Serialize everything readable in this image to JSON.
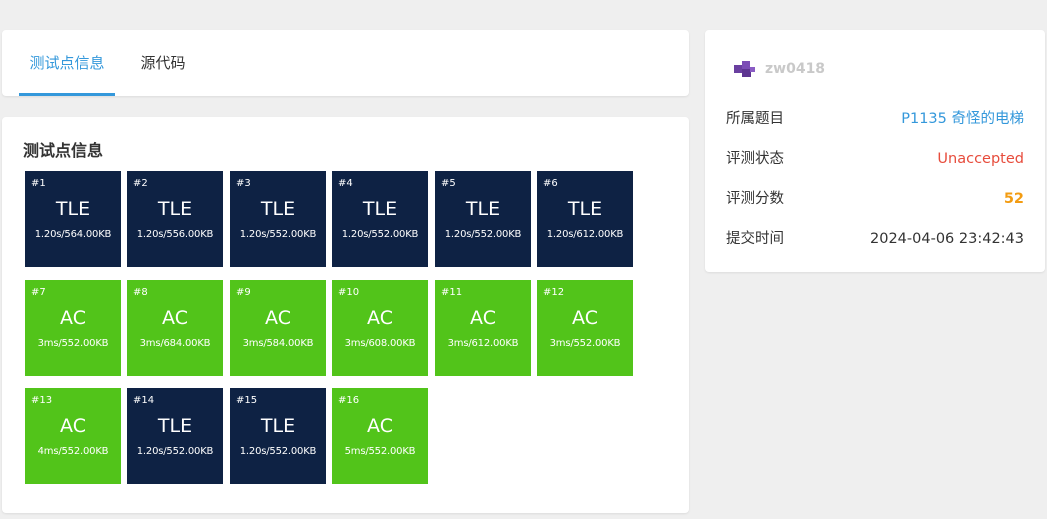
{
  "tabs": [
    {
      "label": "测试点信息",
      "active": true
    },
    {
      "label": "源代码",
      "active": false
    }
  ],
  "tests_title": "测试点信息",
  "testcases": [
    {
      "num": "#1",
      "status": "TLE",
      "result": "1.20s/564.00KB"
    },
    {
      "num": "#2",
      "status": "TLE",
      "result": "1.20s/556.00KB"
    },
    {
      "num": "#3",
      "status": "TLE",
      "result": "1.20s/552.00KB"
    },
    {
      "num": "#4",
      "status": "TLE",
      "result": "1.20s/552.00KB"
    },
    {
      "num": "#5",
      "status": "TLE",
      "result": "1.20s/552.00KB"
    },
    {
      "num": "#6",
      "status": "TLE",
      "result": "1.20s/612.00KB"
    },
    {
      "num": "#7",
      "status": "AC",
      "result": "3ms/552.00KB"
    },
    {
      "num": "#8",
      "status": "AC",
      "result": "3ms/684.00KB"
    },
    {
      "num": "#9",
      "status": "AC",
      "result": "3ms/584.00KB"
    },
    {
      "num": "#10",
      "status": "AC",
      "result": "3ms/608.00KB"
    },
    {
      "num": "#11",
      "status": "AC",
      "result": "3ms/612.00KB"
    },
    {
      "num": "#12",
      "status": "AC",
      "result": "3ms/552.00KB"
    },
    {
      "num": "#13",
      "status": "AC",
      "result": "4ms/552.00KB"
    },
    {
      "num": "#14",
      "status": "TLE",
      "result": "1.20s/552.00KB"
    },
    {
      "num": "#15",
      "status": "TLE",
      "result": "1.20s/552.00KB"
    },
    {
      "num": "#16",
      "status": "AC",
      "result": "5ms/552.00KB"
    }
  ],
  "colors": {
    "tle": "#0e2244",
    "ac": "#52c41a",
    "accent": "#3498db",
    "status_unaccepted": "#e74c3c",
    "score": "#f39c12"
  },
  "user": {
    "name": "zw0418",
    "avatar_icon": "puzzle-avatar-icon"
  },
  "info": {
    "problem_label": "所属题目",
    "problem_value": "P1135 奇怪的电梯",
    "status_label": "评测状态",
    "status_value": "Unaccepted",
    "score_label": "评测分数",
    "score_value": "52",
    "time_label": "提交时间",
    "time_value": "2024-04-06 23:42:43"
  }
}
